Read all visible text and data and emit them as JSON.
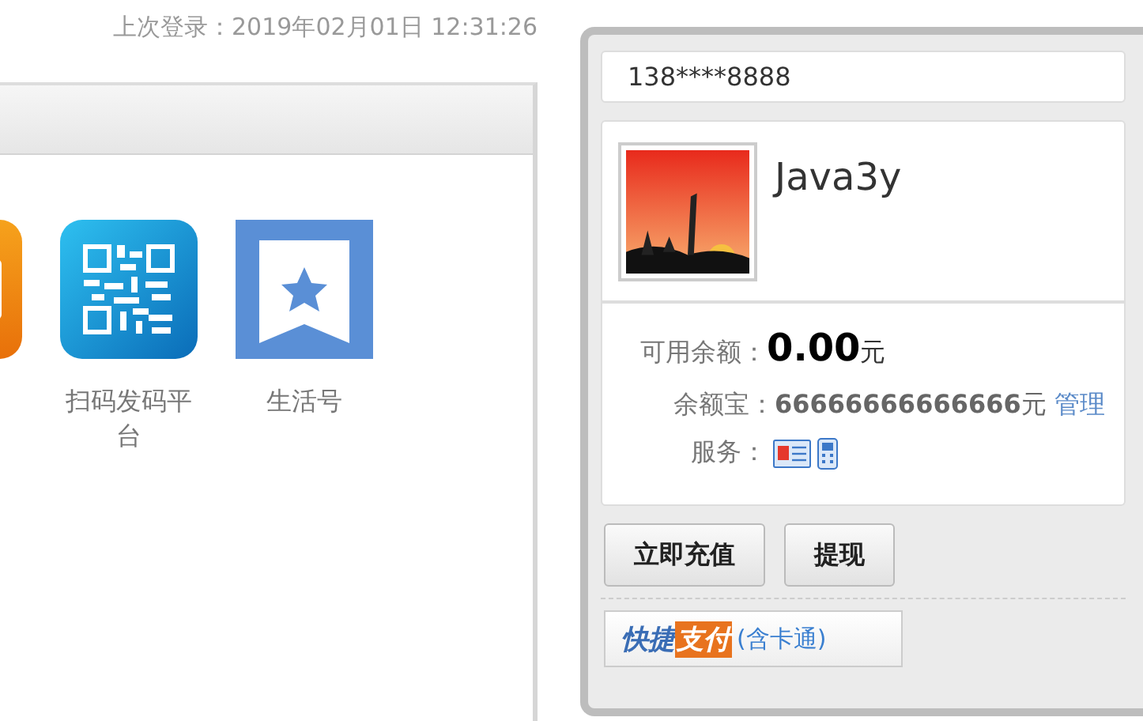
{
  "last_login": "上次登录：2019年02月01日 12:31:26",
  "apps": [
    {
      "kind": "orange"
    },
    {
      "kind": "qr",
      "label": "扫码发码平台"
    },
    {
      "kind": "bookmark",
      "label": "生活号"
    }
  ],
  "account": {
    "phone": "138****8888",
    "name": "Java3y",
    "balance": {
      "label": "可用余额：",
      "amount": "0.00",
      "unit": "元"
    },
    "yuebao": {
      "label": "余额宝：",
      "amount": "66666666666666",
      "unit": "元",
      "link": "管理"
    },
    "services": {
      "label": "服务：",
      "icons": [
        {
          "kind": "id-card"
        },
        {
          "kind": "phone"
        }
      ]
    }
  },
  "buttons": [
    "立即充值",
    "提现"
  ],
  "quickpay": {
    "brand": "快捷",
    "highlight": "支付",
    "note": "(含卡通)"
  }
}
